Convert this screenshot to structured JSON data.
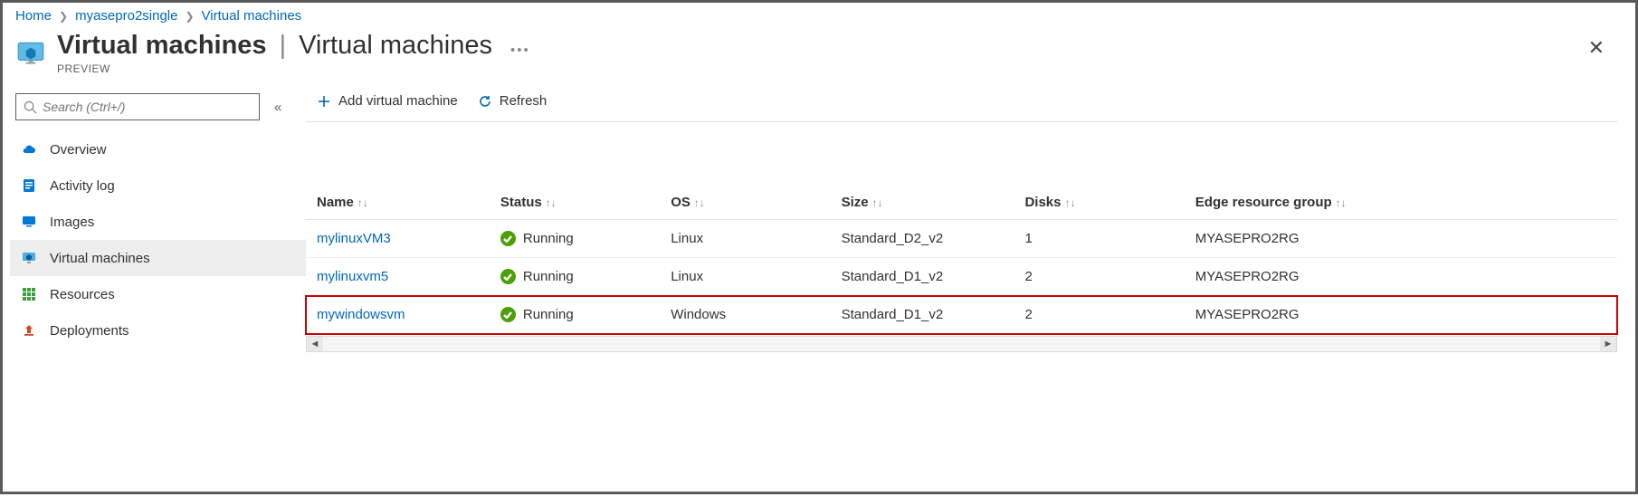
{
  "breadcrumb": {
    "home": "Home",
    "resource": "myasepro2single",
    "page": "Virtual machines"
  },
  "header": {
    "title": "Virtual machines",
    "subtitle": "Virtual machines",
    "preview": "PREVIEW"
  },
  "search": {
    "placeholder": "Search (Ctrl+/)"
  },
  "nav": {
    "overview": "Overview",
    "activity": "Activity log",
    "images": "Images",
    "vms": "Virtual machines",
    "resources": "Resources",
    "deployments": "Deployments"
  },
  "toolbar": {
    "add": "Add virtual machine",
    "refresh": "Refresh"
  },
  "table": {
    "cols": {
      "name": "Name",
      "status": "Status",
      "os": "OS",
      "size": "Size",
      "disks": "Disks",
      "rg": "Edge resource group"
    },
    "rows": [
      {
        "name": "mylinuxVM3",
        "status": "Running",
        "os": "Linux",
        "size": "Standard_D2_v2",
        "disks": "1",
        "rg": "MYASEPRO2RG"
      },
      {
        "name": "mylinuxvm5",
        "status": "Running",
        "os": "Linux",
        "size": "Standard_D1_v2",
        "disks": "2",
        "rg": "MYASEPRO2RG"
      },
      {
        "name": "mywindowsvm",
        "status": "Running",
        "os": "Windows",
        "size": "Standard_D1_v2",
        "disks": "2",
        "rg": "MYASEPRO2RG"
      }
    ]
  }
}
